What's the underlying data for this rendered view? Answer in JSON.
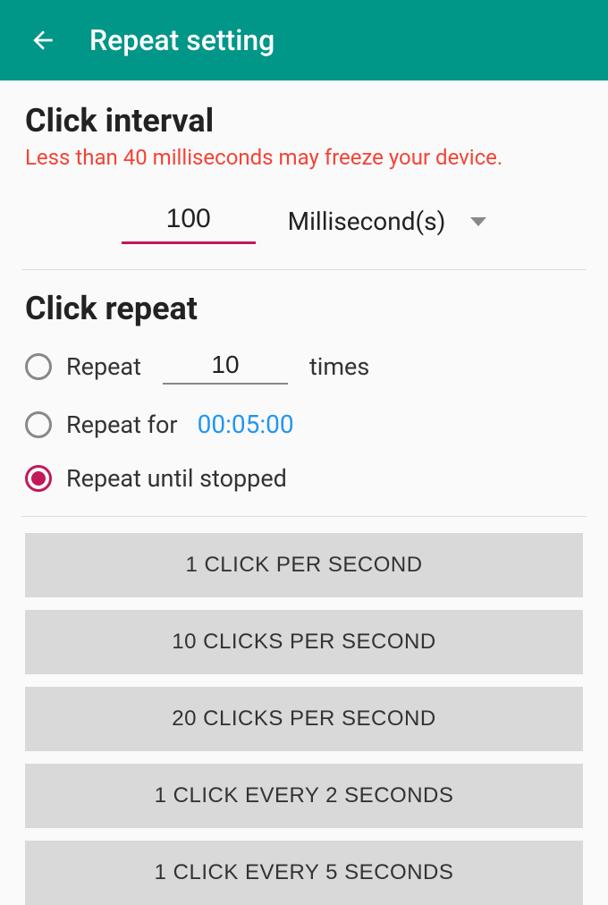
{
  "appbar": {
    "title": "Repeat setting"
  },
  "interval": {
    "title": "Click interval",
    "warning": "Less than 40 milliseconds may freeze your device.",
    "value": "100",
    "unit": "Millisecond(s)"
  },
  "repeat": {
    "title": "Click repeat",
    "options": {
      "times": {
        "label_pre": "Repeat",
        "value": "10",
        "label_post": "times",
        "selected": false
      },
      "duration": {
        "label": "Repeat for",
        "value": "00:05:00",
        "selected": false
      },
      "until_stopped": {
        "label": "Repeat until stopped",
        "selected": true
      }
    }
  },
  "presets": [
    "1 CLICK PER SECOND",
    "10 CLICKS PER SECOND",
    "20 CLICKS PER SECOND",
    "1 CLICK EVERY 2 SECONDS",
    "1 CLICK EVERY 5 SECONDS"
  ]
}
